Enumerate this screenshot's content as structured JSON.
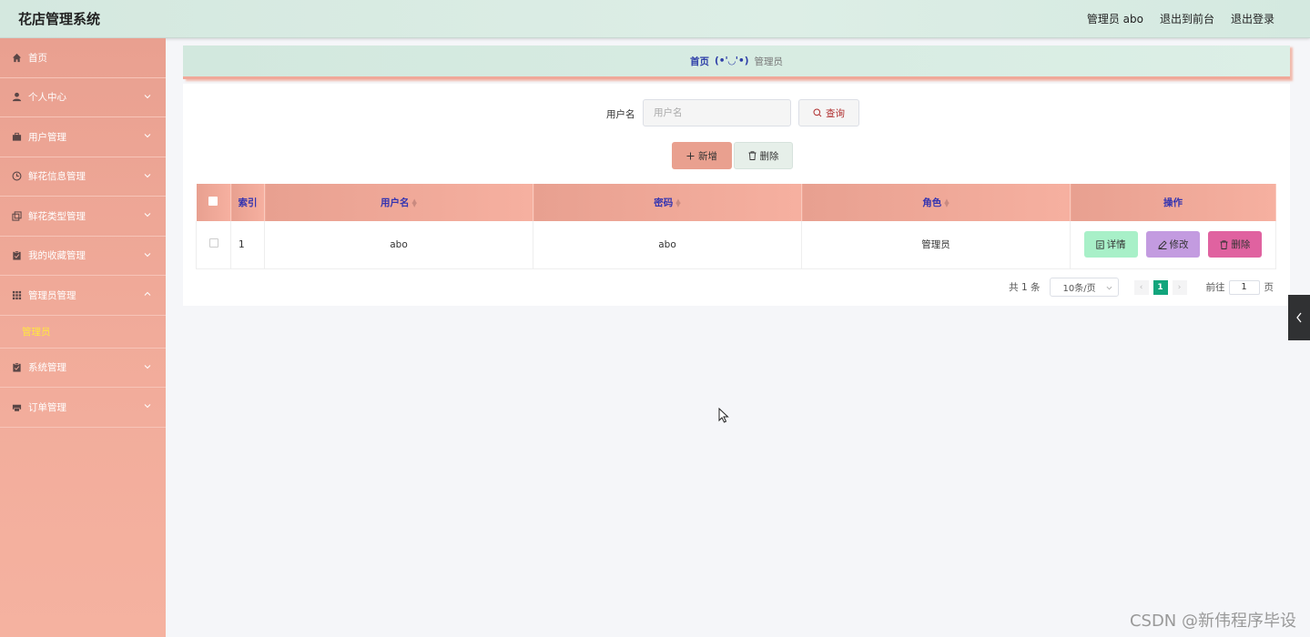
{
  "header": {
    "app_title": "花店管理系统",
    "user_label": "管理员 abo",
    "front_link": "退出到前台",
    "logout_link": "退出登录"
  },
  "sidebar": {
    "items": [
      {
        "label": "首页",
        "icon": "home-icon"
      },
      {
        "label": "个人中心",
        "icon": "user-icon"
      },
      {
        "label": "用户管理",
        "icon": "briefcase-icon"
      },
      {
        "label": "鲜花信息管理",
        "icon": "clock-icon"
      },
      {
        "label": "鲜花类型管理",
        "icon": "copy-icon"
      },
      {
        "label": "我的收藏管理",
        "icon": "clipboard-icon"
      },
      {
        "label": "管理员管理",
        "icon": "grid-icon"
      },
      {
        "label": "系统管理",
        "icon": "clipboard-icon"
      },
      {
        "label": "订单管理",
        "icon": "printer-icon"
      }
    ],
    "active_sub": "管理员"
  },
  "breadcrumb": {
    "home": "首页",
    "face": "(•'◡'•)",
    "current": "管理员"
  },
  "search": {
    "label": "用户名",
    "placeholder": "用户名",
    "query_button": "查询"
  },
  "actions": {
    "add": "新增",
    "delete": "删除"
  },
  "table": {
    "headers": [
      "索引",
      "用户名",
      "密码",
      "角色",
      "操作"
    ],
    "rows": [
      {
        "index": "1",
        "username": "abo",
        "password": "abo",
        "role": "管理员"
      }
    ],
    "ops": {
      "detail": "详情",
      "edit": "修改",
      "remove": "删除"
    }
  },
  "pagination": {
    "total": "共 1 条",
    "page_size": "10条/页",
    "current_page": "1",
    "goto_label": "前往",
    "goto_value": "1",
    "goto_suffix": "页"
  },
  "watermark": "CSDN @新伟程序毕设",
  "colors": {
    "sidebar": "#f1ab9a",
    "header": "#d4e8df",
    "active_sub": "#ffe640",
    "page_active": "#12a57c"
  }
}
